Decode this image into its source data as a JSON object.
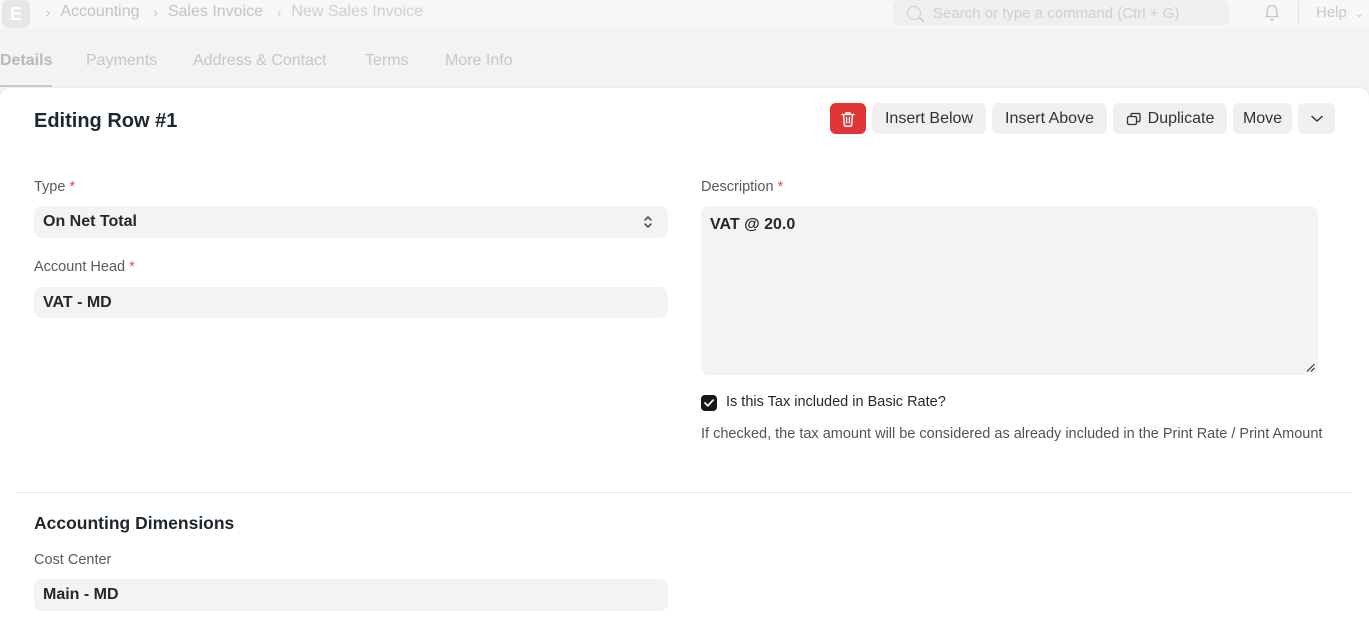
{
  "navbar": {
    "logo_letter": "E",
    "breadcrumbs": [
      "Accounting",
      "Sales Invoice",
      "New Sales Invoice"
    ],
    "search_placeholder": "Search or type a command (Ctrl + G)",
    "help_label": "Help"
  },
  "tabs": [
    {
      "label": "Details",
      "active": true
    },
    {
      "label": "Payments",
      "active": false
    },
    {
      "label": "Address & Contact",
      "active": false
    },
    {
      "label": "Terms",
      "active": false
    },
    {
      "label": "More Info",
      "active": false
    }
  ],
  "panel": {
    "title": "Editing Row #1",
    "buttons": {
      "delete_icon": "trash-icon",
      "insert_below": "Insert Below",
      "insert_above": "Insert Above",
      "duplicate": "Duplicate",
      "move": "Move",
      "more_icon": "chevron-down-icon"
    },
    "fields": {
      "type": {
        "label": "Type",
        "required_mark": "*",
        "value": "On Net Total"
      },
      "account_head": {
        "label": "Account Head",
        "required_mark": "*",
        "value": "VAT - MD"
      },
      "description": {
        "label": "Description",
        "required_mark": "*",
        "value": "VAT @ 20.0"
      },
      "included_in_basic_rate": {
        "label": "Is this Tax included in Basic Rate?",
        "checked": true,
        "help": "If checked, the tax amount will be considered as already included in the Print Rate / Print Amount"
      }
    },
    "accounting_dimensions": {
      "title": "Accounting Dimensions",
      "cost_center": {
        "label": "Cost Center",
        "value": "Main - MD"
      }
    }
  },
  "colors": {
    "danger": "#e03636",
    "required": "#e24c4c",
    "control_bg": "#f3f3f3"
  }
}
